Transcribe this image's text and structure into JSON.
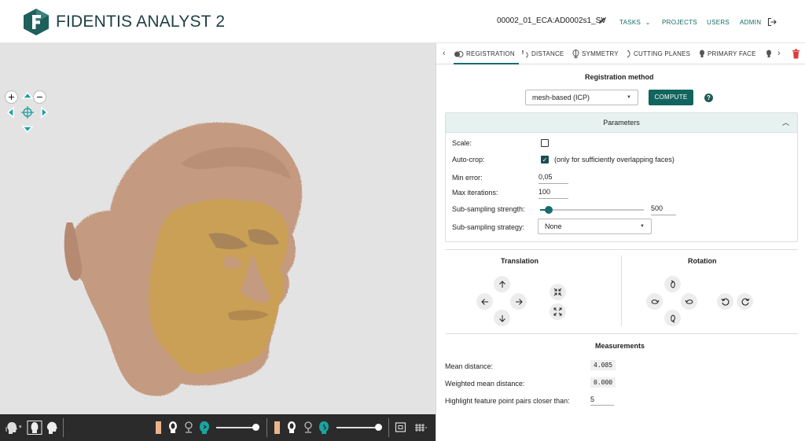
{
  "header": {
    "app_title": "FIDENTIS ANALYST 2",
    "project_id": "00002_01_ECA:AD0002s1_SV",
    "nav": {
      "tasks": "TASKS",
      "tasks_caret": "⌄",
      "projects": "PROJECTS",
      "users": "USERS",
      "admin": "ADMIN"
    }
  },
  "viewer": {
    "zoom_in": "+",
    "zoom_out": "−"
  },
  "tabs": {
    "prev": "‹",
    "next": "›",
    "items": [
      {
        "label": "REGISTRATION",
        "active": true
      },
      {
        "label": "DISTANCE"
      },
      {
        "label": "SYMMETRY"
      },
      {
        "label": "CUTTING PLANES"
      },
      {
        "label": "PRIMARY FACE"
      }
    ]
  },
  "registration": {
    "title": "Registration method",
    "method": "mesh-based (ICP)",
    "compute": "COMPUTE",
    "help": "?"
  },
  "parameters": {
    "title": "Parameters",
    "scale_label": "Scale:",
    "scale_checked": false,
    "autocrop_label": "Auto-crop:",
    "autocrop_checked": true,
    "autocrop_note": "(only for sufficiently overlapping faces)",
    "min_error_label": "Min error:",
    "min_error": "0,05",
    "max_iter_label": "Max iterations:",
    "max_iter": "100",
    "subsampling_strength_label": "Sub-sampling strength:",
    "subsampling_strength": "500",
    "subsampling_strategy_label": "Sub-sampling strategy:",
    "subsampling_strategy": "None"
  },
  "transform": {
    "translation_title": "Translation",
    "rotation_title": "Rotation"
  },
  "measurements": {
    "title": "Measurements",
    "mean_label": "Mean distance:",
    "mean_value": "4.085",
    "weighted_label": "Weighted mean distance:",
    "weighted_value": "0.000",
    "highlight_label": "Highlight feature point pairs closer than:",
    "highlight_value": "5"
  },
  "colors": {
    "brand": "#1a6b6e",
    "primary_face": "#c49a80",
    "secondary_face": "#c9a050"
  }
}
